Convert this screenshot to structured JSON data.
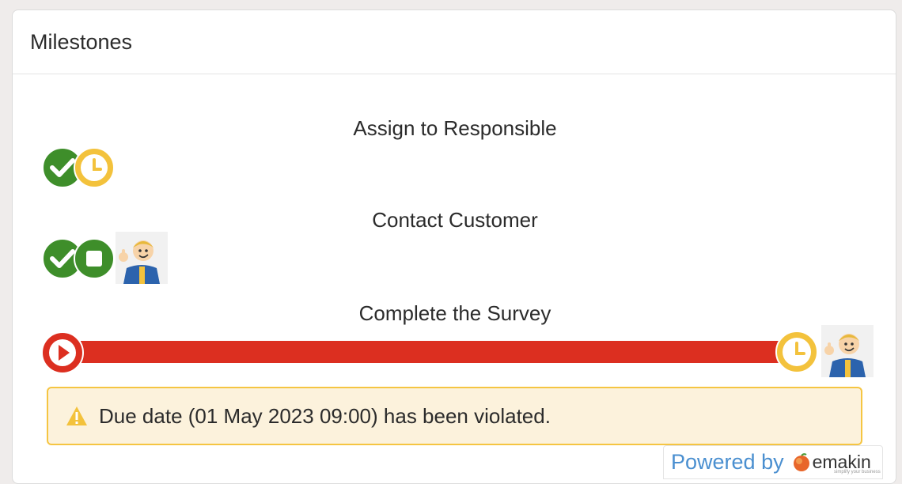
{
  "header": {
    "title": "Milestones"
  },
  "milestones": [
    {
      "title": "Assign to Responsible"
    },
    {
      "title": "Contact Customer"
    },
    {
      "title": "Complete the Survey",
      "progress": 1.0
    }
  ],
  "alert": {
    "message": "Due date (01 May 2023 09:00) has been violated."
  },
  "footer": {
    "powered_by": "Powered by",
    "brand": "emakin",
    "tagline": "simplify your business"
  },
  "colors": {
    "done_green": "#3e8e2a",
    "pending_yellow": "#f3c23c",
    "overdue_red": "#dc2f20",
    "alert_bg": "#fcf2dc",
    "link_blue": "#4a8fd0"
  },
  "icons": [
    "check-circle-icon",
    "clock-icon",
    "stop-circle-icon",
    "play-circle-icon",
    "warning-icon",
    "avatar",
    "emakin-logo-icon"
  ]
}
